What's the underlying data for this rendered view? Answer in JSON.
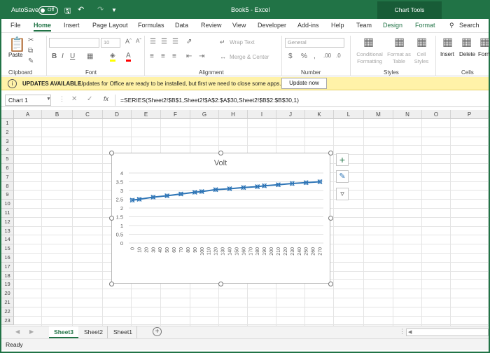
{
  "titlebar": {
    "autosave": "AutoSave",
    "toggle": "Off",
    "title": "Book5  -  Excel",
    "context": "Chart Tools"
  },
  "tabs": [
    "File",
    "Home",
    "Insert",
    "Page Layout",
    "Formulas",
    "Data",
    "Review",
    "View",
    "Developer",
    "Add-ins",
    "Help",
    "Team",
    "Design",
    "Format"
  ],
  "search_label": "Search",
  "ribbon": {
    "paste": "Paste",
    "clipboard": "Clipboard",
    "font_size": "10",
    "font": "Font",
    "wrap": "Wrap Text",
    "merge": "Merge & Center",
    "alignment": "Alignment",
    "number_format": "General",
    "number": "Number",
    "cond1": "Conditional",
    "cond2": "Formatting",
    "fmt1": "Format as",
    "fmt2": "Table",
    "cell1": "Cell",
    "cell2": "Styles",
    "styles": "Styles",
    "insert": "Insert",
    "delete": "Delete",
    "format": "Form",
    "cells": "Cells"
  },
  "notification": {
    "bold": "UPDATES AVAILABLE",
    "message": "Updates for Office are ready to be installed, but first we need to close some apps.",
    "button": "Update now"
  },
  "namebox": "Chart 1",
  "formula": "=SERIES(Sheet2!$B$1,Sheet2!$A$2:$A$30,Sheet2!$B$2:$B$30,1)",
  "columns": [
    "A",
    "B",
    "C",
    "D",
    "E",
    "F",
    "G",
    "H",
    "I",
    "J",
    "K",
    "L",
    "M",
    "N",
    "O",
    "P"
  ],
  "rows": [
    "1",
    "2",
    "3",
    "4",
    "5",
    "6",
    "7",
    "8",
    "9",
    "10",
    "11",
    "12",
    "13",
    "14",
    "15",
    "16",
    "17",
    "18",
    "19",
    "20",
    "21",
    "22",
    "23"
  ],
  "sheets": [
    "Sheet3",
    "Sheet2",
    "Sheet1"
  ],
  "status": "Ready",
  "accent": "#217346",
  "chart_data": {
    "type": "line",
    "title": "Volt",
    "xlabel": "",
    "ylabel": "",
    "categories": [
      "0",
      "10",
      "20",
      "30",
      "40",
      "50",
      "60",
      "70",
      "80",
      "90",
      "100",
      "110",
      "120",
      "130",
      "140",
      "150",
      "160",
      "170",
      "180",
      "190",
      "200",
      "210",
      "220",
      "230",
      "240",
      "250",
      "260",
      "270"
    ],
    "ylim": [
      0,
      4
    ],
    "yticks": [
      "0",
      "0.5",
      "1",
      "1.5",
      "2",
      "2.5",
      "3",
      "3.5",
      "4"
    ],
    "marker_x": [
      0,
      10,
      30,
      50,
      70,
      90,
      100,
      120,
      140,
      160,
      180,
      190,
      210,
      230,
      250,
      270
    ],
    "marker_y": [
      2.45,
      2.5,
      2.62,
      2.7,
      2.8,
      2.9,
      2.94,
      3.05,
      3.1,
      3.17,
      3.22,
      3.27,
      3.33,
      3.4,
      3.45,
      3.5
    ],
    "grid": true,
    "line_color": "#2e75b6"
  }
}
